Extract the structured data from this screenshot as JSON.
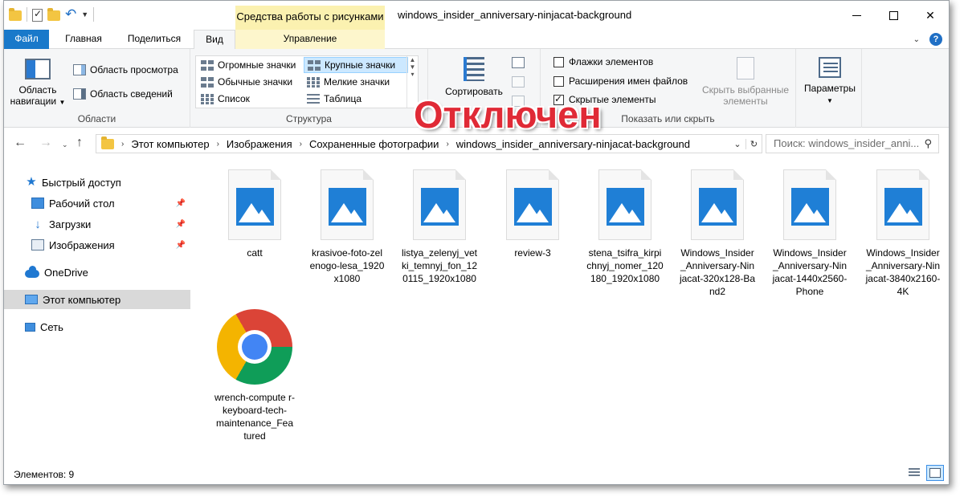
{
  "window": {
    "title": "windows_insider_anniversary-ninjacat-background",
    "contextual_tab_header": "Средства работы с рисунками"
  },
  "tabs": [
    {
      "label": "Файл"
    },
    {
      "label": "Главная"
    },
    {
      "label": "Поделиться"
    },
    {
      "label": "Вид"
    },
    {
      "label": "Управление"
    }
  ],
  "ribbon": {
    "areas": {
      "label": "Области",
      "nav_pane": "Область навигации",
      "preview_pane": "Область просмотра",
      "details_pane": "Область сведений"
    },
    "layout": {
      "label": "Структура",
      "items": [
        "Огромные значки",
        "Крупные значки",
        "Обычные значки",
        "Мелкие значки",
        "Список",
        "Таблица"
      ]
    },
    "current_view": {
      "sort_label": "Сортировать"
    },
    "show_hide": {
      "label": "Показать или скрыть",
      "item_checkboxes": "Флажки элементов",
      "file_extensions": "Расширения имен файлов",
      "hidden_items": "Скрытые элементы",
      "hide_selected": "Скрыть выбранные элементы"
    },
    "options_label": "Параметры"
  },
  "overlay": {
    "text": "Отключен",
    "color": "#e02a36"
  },
  "address_bar": {
    "crumbs": [
      "Этот компьютер",
      "Изображения",
      "Сохраненные фотографии",
      "windows_insider_anniversary-ninjacat-background"
    ],
    "search_placeholder": "Поиск: windows_insider_anni..."
  },
  "sidebar": {
    "items": [
      {
        "label": "Быстрый доступ",
        "icon": "star-icon"
      },
      {
        "label": "Рабочий стол",
        "icon": "desktop-icon",
        "pinned": true
      },
      {
        "label": "Загрузки",
        "icon": "download-icon",
        "pinned": true
      },
      {
        "label": "Изображения",
        "icon": "pictures-icon",
        "pinned": true
      },
      {
        "label": "OneDrive",
        "icon": "cloud-icon"
      },
      {
        "label": "Этот компьютер",
        "icon": "computer-icon",
        "selected": true
      },
      {
        "label": "Сеть",
        "icon": "network-icon"
      }
    ]
  },
  "files": [
    {
      "name": "catt",
      "type": "image"
    },
    {
      "name": "krasivoe-foto-zel enogo-lesa_1920 x1080",
      "type": "image"
    },
    {
      "name": "listya_zelenyj_vet ki_temnyj_fon_12 0115_1920x1080",
      "type": "image"
    },
    {
      "name": "review-3",
      "type": "image"
    },
    {
      "name": "stena_tsifra_kirpi chnyj_nomer_120 180_1920x1080",
      "type": "image"
    },
    {
      "name": "Windows_Insider _Anniversary-Nin jacat-320x128-Ba nd2",
      "type": "image"
    },
    {
      "name": "Windows_Insider _Anniversary-Nin jacat-1440x2560- Phone",
      "type": "image"
    },
    {
      "name": "Windows_Insider _Anniversary-Nin jacat-3840x2160- 4K",
      "type": "image"
    },
    {
      "name": "wrench-compute r-keyboard-tech- maintenance_Fea tured",
      "type": "chrome"
    }
  ],
  "status": {
    "count": "Элементов: 9"
  },
  "colors": {
    "accent": "#1979ca",
    "contextual_tab": "#fbf1b0",
    "selection": "#cce8ff"
  }
}
